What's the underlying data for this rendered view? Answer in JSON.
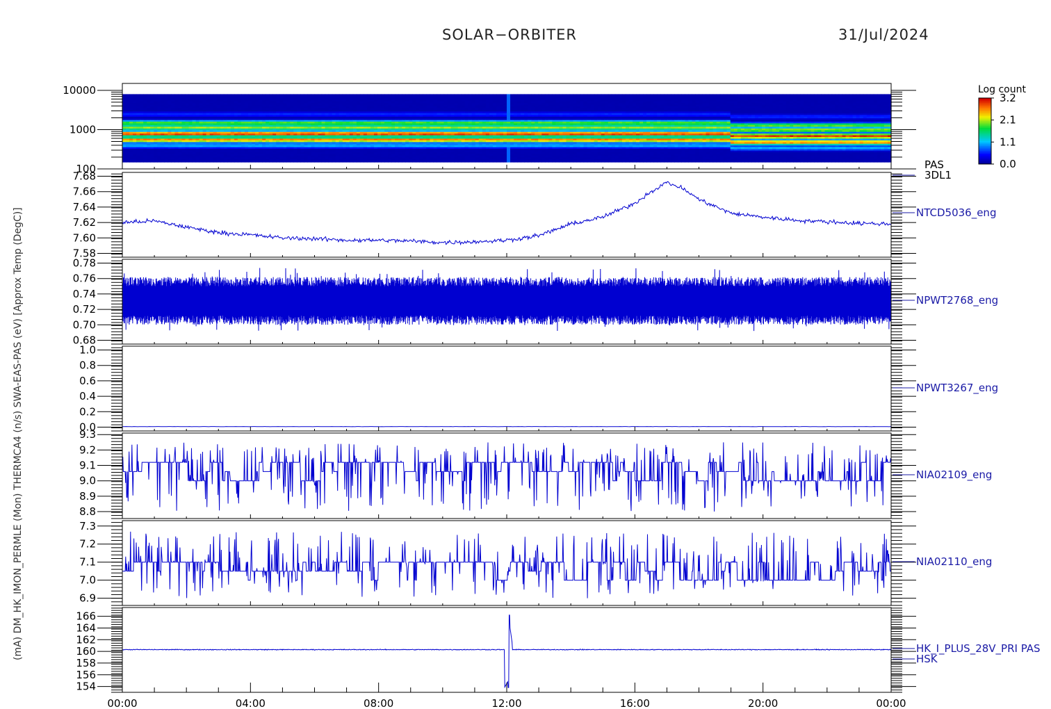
{
  "header": {
    "title": "SOLAR−ORBITER",
    "date": "31/Jul/2024"
  },
  "ylabel_left": "(mA) DM_HK_IMON_PERMLE (Mon) THERMCA4 (n/s) SWA-EAS-PAS (eV) [Approx Temp (DegC)]",
  "colors": {
    "trace": "#0000d0",
    "label": "#1a1aa6",
    "axis": "#000000"
  },
  "chart_data": [
    {
      "type": "heatmap",
      "id": "pas-3dl1",
      "labels": [
        "PAS",
        "3DL1"
      ],
      "ylog": true,
      "ylim": [
        100,
        15000
      ],
      "yticks": [
        "10000",
        "1000",
        "100"
      ],
      "ytick_values": [
        10000,
        1000,
        100
      ],
      "colorbar": {
        "title": "Log count",
        "ticks": [
          "3.2",
          "2.1",
          "1.1",
          "0.0"
        ],
        "range": [
          0.0,
          3.2
        ]
      },
      "energy_bands": [
        {
          "energy_eV": 400,
          "level": 0.35
        },
        {
          "energy_eV": 560,
          "level": 0.9
        },
        {
          "energy_eV": 800,
          "level": 1.0
        },
        {
          "energy_eV": 1150,
          "level": 0.7
        },
        {
          "energy_eV": 1500,
          "level": 0.65
        },
        {
          "energy_eV": 2500,
          "level": 0.2
        }
      ],
      "spike_hour": 12.05
    },
    {
      "type": "line",
      "id": "ntcd5036",
      "label": "NTCD5036_eng",
      "ylim": [
        7.575,
        7.685
      ],
      "yticks": [
        "7.68",
        "7.66",
        "7.64",
        "7.62",
        "7.60",
        "7.58"
      ],
      "ytick_values": [
        7.68,
        7.66,
        7.64,
        7.62,
        7.6,
        7.58
      ],
      "x": [
        0,
        1,
        2,
        3,
        4,
        5,
        6,
        7,
        8,
        9,
        10,
        11,
        12,
        13,
        14,
        15,
        16,
        16.5,
        17,
        17.5,
        18,
        19,
        20,
        21,
        22,
        23,
        24
      ],
      "y": [
        7.62,
        7.622,
        7.614,
        7.607,
        7.604,
        7.6,
        7.599,
        7.597,
        7.597,
        7.596,
        7.594,
        7.595,
        7.597,
        7.603,
        7.618,
        7.627,
        7.645,
        7.66,
        7.672,
        7.664,
        7.65,
        7.632,
        7.627,
        7.623,
        7.621,
        7.619,
        7.618
      ],
      "noise": 0.004
    },
    {
      "type": "line",
      "id": "npwt2768",
      "label": "NPWT2768_eng",
      "ylim": [
        0.675,
        0.785
      ],
      "yticks": [
        "0.78",
        "0.76",
        "0.74",
        "0.72",
        "0.70",
        "0.68"
      ],
      "ytick_values": [
        0.78,
        0.76,
        0.74,
        0.72,
        0.7,
        0.68
      ],
      "band_low": 0.7,
      "band_high": 0.762,
      "center": 0.731
    },
    {
      "type": "line",
      "id": "npwt3267",
      "label": "NPWT3267_eng",
      "ylim": [
        -0.05,
        1.05
      ],
      "yticks": [
        "1.0",
        "0.8",
        "0.6",
        "0.4",
        "0.2",
        "0.0"
      ],
      "ytick_values": [
        1.0,
        0.8,
        0.6,
        0.4,
        0.2,
        0.0
      ],
      "value": 0.005
    },
    {
      "type": "line",
      "id": "nia02109",
      "label": "NIA02109_eng",
      "ylim": [
        8.755,
        9.31
      ],
      "yticks": [
        "9.3",
        "9.2",
        "9.1",
        "9.0",
        "8.9",
        "8.8"
      ],
      "ytick_values": [
        9.3,
        9.2,
        9.1,
        9.0,
        8.9,
        8.8
      ],
      "levels": [
        9.0,
        9.06,
        9.12
      ],
      "spike_range": [
        8.8,
        9.25
      ]
    },
    {
      "type": "line",
      "id": "nia02110",
      "label": "NIA02110_eng",
      "ylim": [
        6.86,
        7.33
      ],
      "yticks": [
        "7.3",
        "7.2",
        "7.1",
        "7.0",
        "6.9"
      ],
      "ytick_values": [
        7.3,
        7.2,
        7.1,
        7.0,
        6.9
      ],
      "levels": [
        7.0,
        7.05,
        7.1
      ],
      "spike_range": [
        6.9,
        7.27
      ]
    },
    {
      "type": "line",
      "id": "hk-i-plus-28v",
      "labels": [
        "HK_I_PLUS_28V_PRI PAS",
        "HSK"
      ],
      "ylim": [
        153,
        167.5
      ],
      "yticks": [
        "166",
        "164",
        "162",
        "160",
        "158",
        "156",
        "154"
      ],
      "ytick_values": [
        166,
        164,
        162,
        160,
        158,
        156,
        154
      ],
      "value": 160.3,
      "spike": {
        "hour": 12.05,
        "min": 153.8,
        "max": 166.2
      }
    }
  ],
  "x_axis": {
    "xlim": [
      0,
      24
    ],
    "ticks": [
      "00:00",
      "04:00",
      "08:00",
      "12:00",
      "16:00",
      "20:00",
      "00:00"
    ],
    "tick_hours": [
      0,
      4,
      8,
      12,
      16,
      20,
      24
    ]
  }
}
